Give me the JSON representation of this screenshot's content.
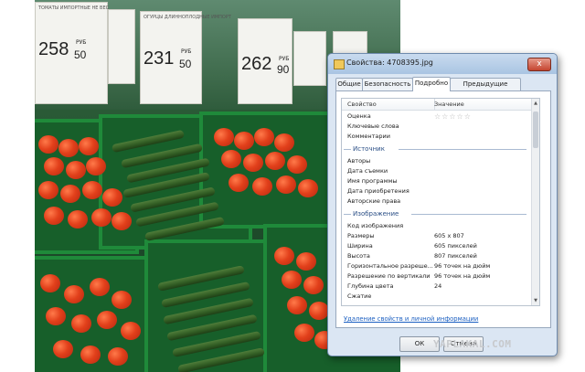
{
  "photo": {
    "cards": [
      {
        "tag": "ТОМАТЫ ИМПОРТНЫЕ НЕ ВЕС",
        "rub_label": "РУБ",
        "rubles": "258",
        "kopecks": "50"
      },
      {
        "tag": "ОГУРЦЫ ДЛИННОПЛОДНЫЕ ИМПОРТ",
        "rub_label": "РУБ",
        "rubles": "231",
        "kopecks": "50"
      },
      {
        "tag": "",
        "rub_label": "РУБ",
        "rubles": "262",
        "kopecks": "90"
      }
    ]
  },
  "dialog": {
    "title": "Свойства: 4708395.jpg",
    "close_label": "x",
    "tabs": [
      "Общие",
      "Безопасность",
      "Подробно",
      "Предыдущие версии"
    ],
    "active_tab": "Подробно",
    "headers": {
      "property": "Свойство",
      "value": "Значение"
    },
    "rows_top": [
      {
        "k": "Оценка",
        "v": ""
      },
      {
        "k": "Ключевые слова",
        "v": ""
      },
      {
        "k": "Комментарии",
        "v": ""
      }
    ],
    "section_source": "Источник",
    "rows_source": [
      {
        "k": "Авторы",
        "v": ""
      },
      {
        "k": "Дата съемки",
        "v": ""
      },
      {
        "k": "Имя программы",
        "v": ""
      },
      {
        "k": "Дата приобретения",
        "v": ""
      },
      {
        "k": "Авторские права",
        "v": ""
      }
    ],
    "section_image": "Изображение",
    "rows_image": [
      {
        "k": "Код изображения",
        "v": ""
      },
      {
        "k": "Размеры",
        "v": "605 x 807"
      },
      {
        "k": "Ширина",
        "v": "605 пикселей"
      },
      {
        "k": "Высота",
        "v": "807 пикселей"
      },
      {
        "k": "Горизонтальное разреше...",
        "v": "96 точек на дюйм"
      },
      {
        "k": "Разрешение по вертикали",
        "v": "96 точек на дюйм"
      },
      {
        "k": "Глубина цвета",
        "v": "24"
      },
      {
        "k": "Сжатие",
        "v": ""
      }
    ],
    "rating_stars": "☆☆☆☆☆",
    "remove_link": "Удаление свойств и личной информации",
    "ok_label": "ОК",
    "cancel_label": "Отмена"
  },
  "watermark": "YAPLAKAL.COM"
}
